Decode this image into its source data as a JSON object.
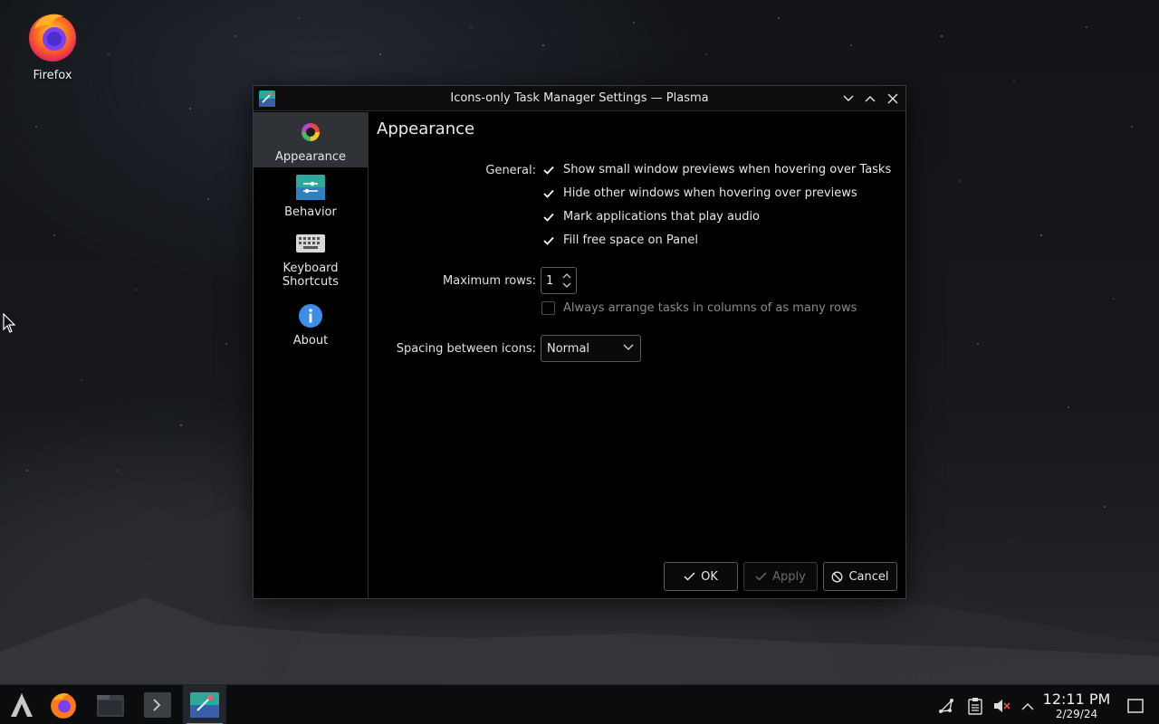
{
  "desktop": {
    "icons": [
      {
        "label": "Firefox",
        "icon": "firefox-icon"
      }
    ]
  },
  "window": {
    "title": "Icons-only Task Manager Settings — Plasma",
    "controls": [
      "minimize",
      "maximize",
      "close"
    ]
  },
  "sidebar": {
    "items": [
      {
        "label": "Appearance",
        "icon": "appearance-icon",
        "active": true
      },
      {
        "label": "Behavior",
        "icon": "behavior-icon",
        "active": false
      },
      {
        "label": "Keyboard\nShortcuts",
        "label_line1": "Keyboard",
        "label_line2": "Shortcuts",
        "icon": "keyboard-icon",
        "active": false
      },
      {
        "label": "About",
        "icon": "info-icon",
        "active": false
      }
    ]
  },
  "page": {
    "heading": "Appearance",
    "general_label": "General:",
    "options": [
      {
        "label": "Show small window previews when hovering over Tasks",
        "checked": true
      },
      {
        "label": "Hide other windows when hovering over previews",
        "checked": true
      },
      {
        "label": "Mark applications that play audio",
        "checked": true
      },
      {
        "label": "Fill free space on Panel",
        "checked": true
      }
    ],
    "max_rows_label": "Maximum rows:",
    "max_rows_value": "1",
    "arrange_columns_label": "Always arrange tasks in columns of as many rows",
    "arrange_columns_checked": false,
    "spacing_label": "Spacing between icons:",
    "spacing_value": "Normal"
  },
  "buttons": {
    "ok": "OK",
    "apply": "Apply",
    "cancel": "Cancel"
  },
  "taskbar": {
    "items": [
      "app-launcher-icon",
      "firefox-icon",
      "file-manager-icon",
      "terminal-icon",
      "task-manager-settings-icon"
    ],
    "tray": [
      "network-icon",
      "clipboard-icon",
      "volume-muted-icon",
      "tray-expand-icon"
    ],
    "time": "12:11 PM",
    "date": "2/29/24"
  },
  "colors": {
    "accent": "#3daee9",
    "window_bg": "#000000",
    "sidebar_active": "#2f3237"
  }
}
